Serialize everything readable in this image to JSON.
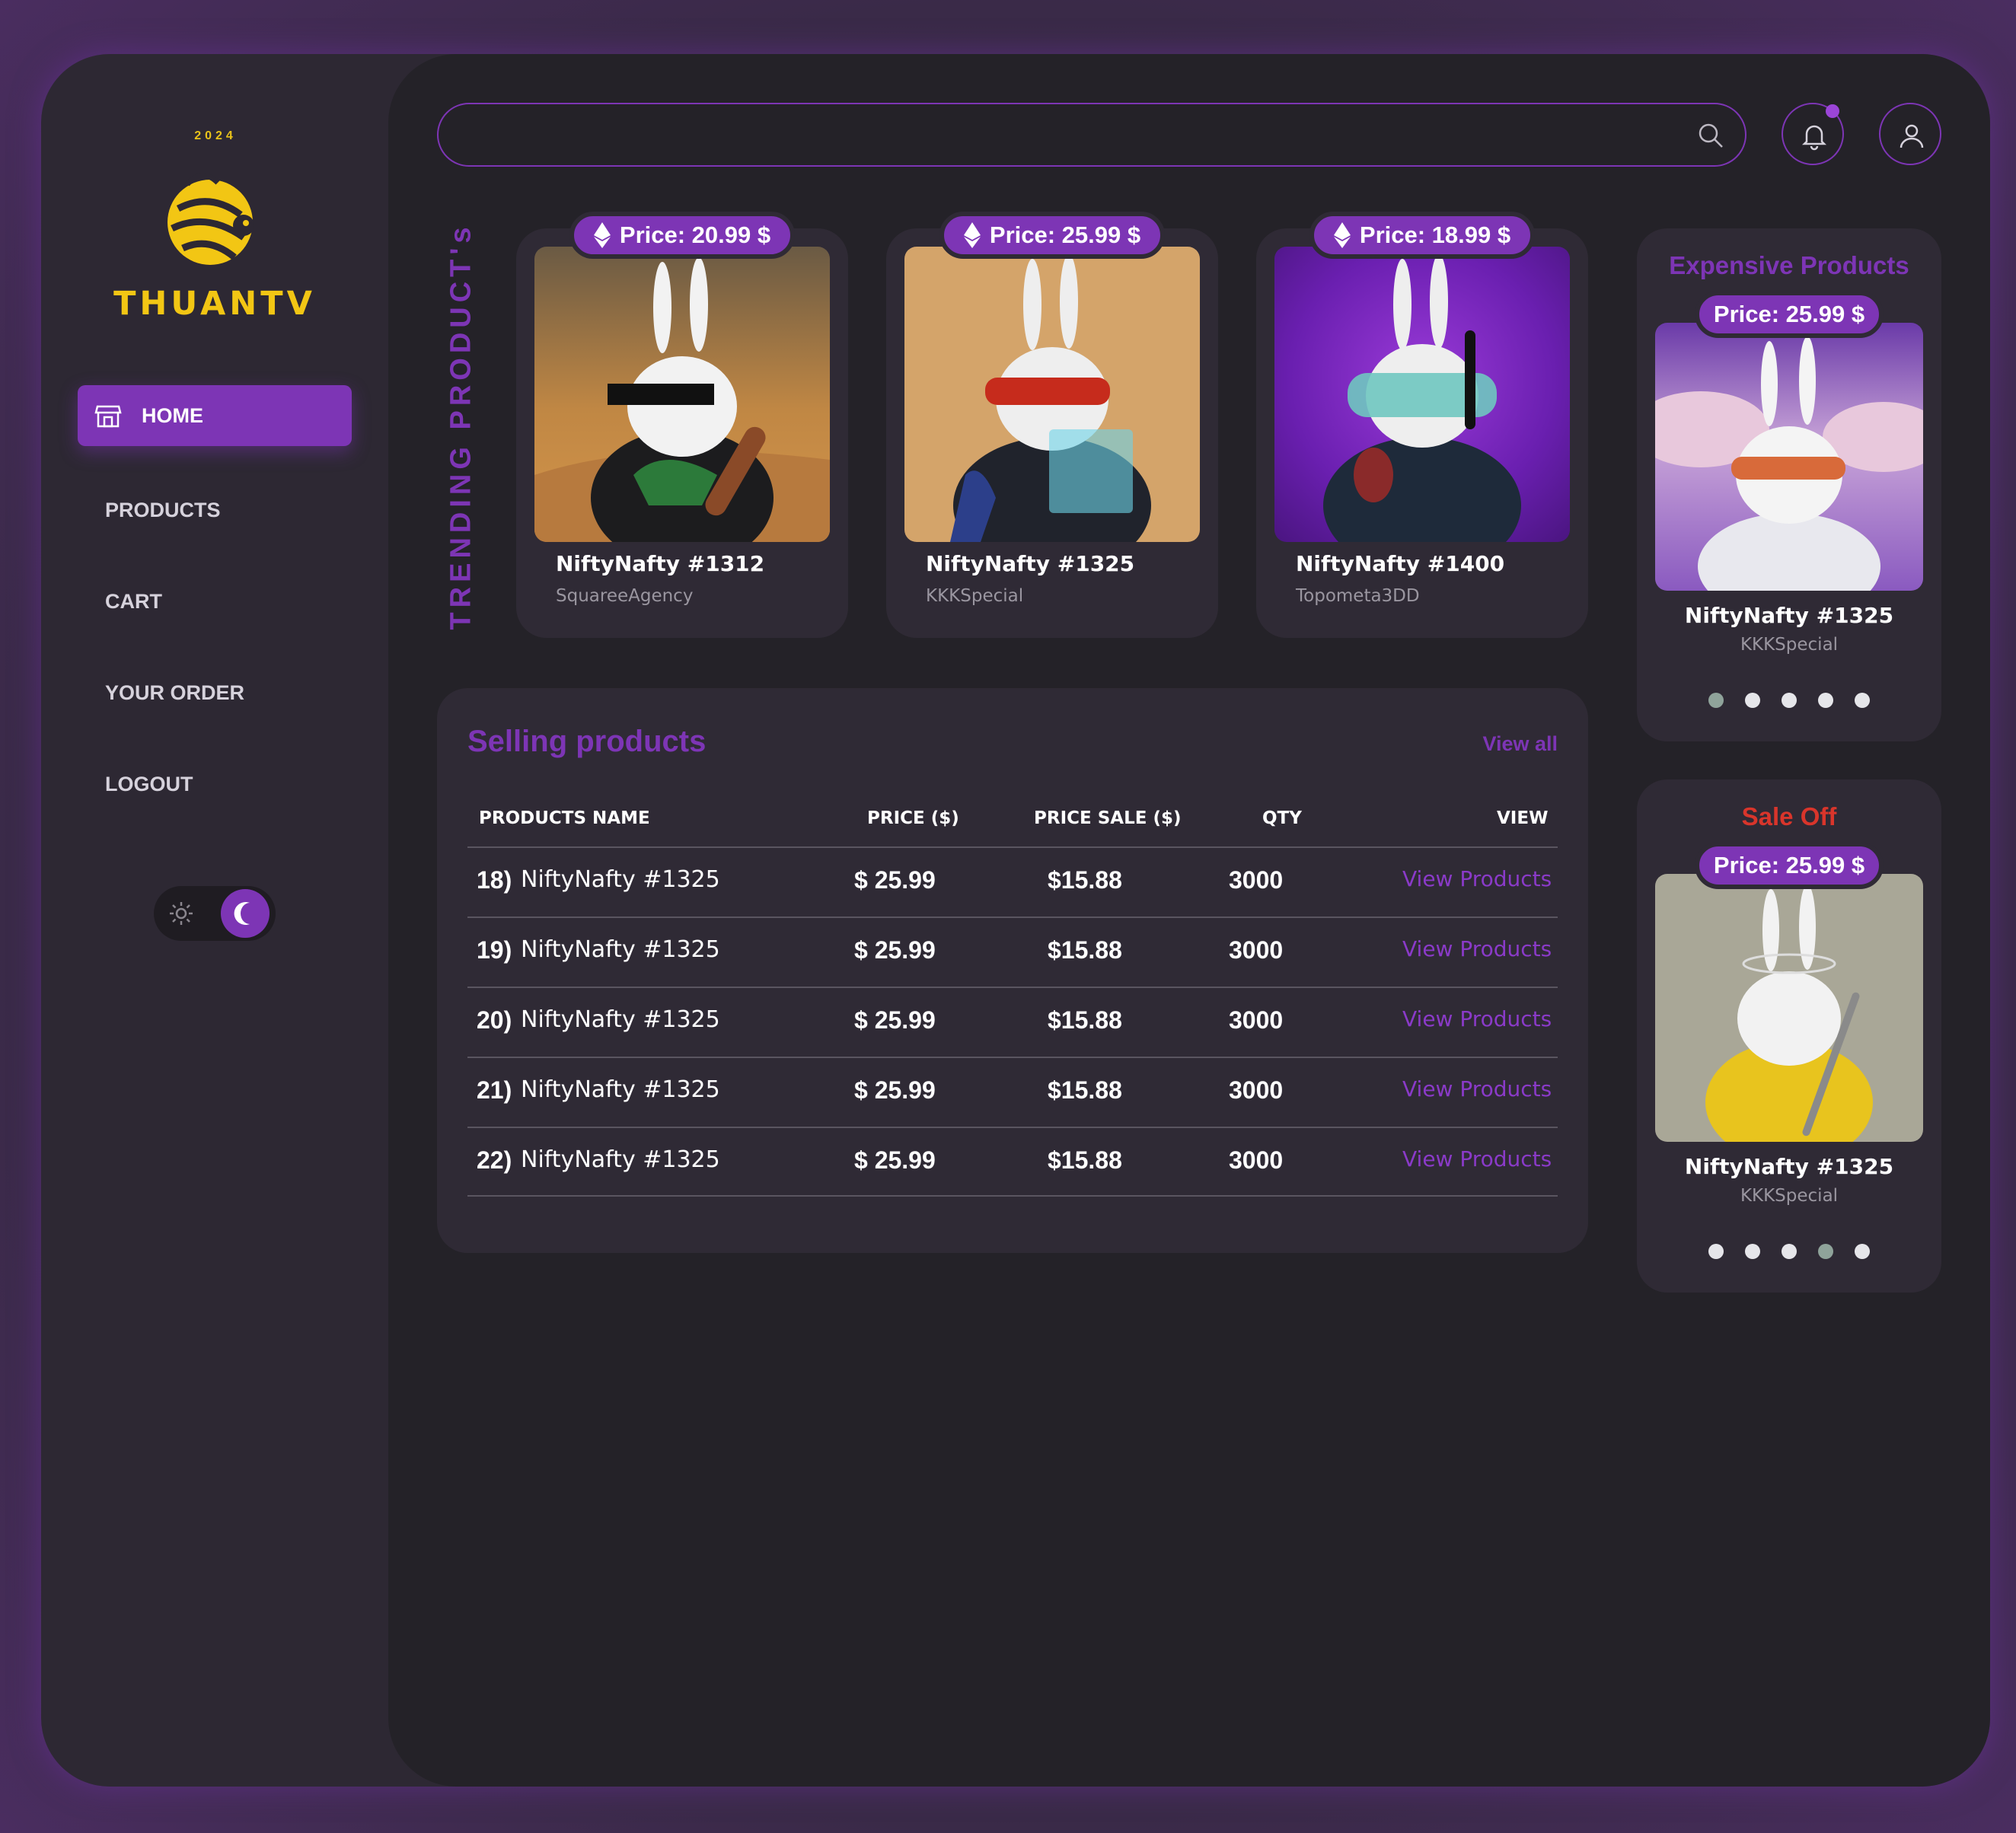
{
  "logo": {
    "year": "2024",
    "name": "THUANTV"
  },
  "colors": {
    "accent": "#7d35b5",
    "logo": "#f2c614",
    "sale": "#d9352b"
  },
  "sidebar": {
    "items": [
      {
        "label": "HOME",
        "active": true,
        "icon": "store-icon"
      },
      {
        "label": "PRODUCTS"
      },
      {
        "label": "CART"
      },
      {
        "label": "YOUR ORDER"
      },
      {
        "label": "LOGOUT"
      }
    ],
    "theme": "dark"
  },
  "header": {
    "search_value": "",
    "search_icon": "search-icon",
    "bell_icon": "bell-icon",
    "user_icon": "user-icon"
  },
  "trending": {
    "label": "TRENDING PRODUCT's",
    "cards": [
      {
        "price": "Price: 20.99 $",
        "name": "NiftyNafty #1312",
        "owner": "SquareeAgency"
      },
      {
        "price": "Price: 25.99 $",
        "name": "NiftyNafty #1325",
        "owner": "KKKSpecial"
      },
      {
        "price": "Price: 18.99 $",
        "name": "NiftyNafty #1400",
        "owner": "Topometa3DD"
      }
    ]
  },
  "selling": {
    "title": "Selling products",
    "view_all": "View all",
    "headers": [
      "PRODUCTS NAME",
      "PRICE ($)",
      "PRICE SALE ($)",
      "QTY",
      "VIEW"
    ],
    "rows": [
      {
        "no": "18)",
        "name": "NiftyNafty #1325",
        "price": "$ 25.99",
        "sale": "$15.88",
        "qty": "3000",
        "view": "View Products"
      },
      {
        "no": "19)",
        "name": "NiftyNafty #1325",
        "price": "$ 25.99",
        "sale": "$15.88",
        "qty": "3000",
        "view": "View Products"
      },
      {
        "no": "20)",
        "name": "NiftyNafty #1325",
        "price": "$ 25.99",
        "sale": "$15.88",
        "qty": "3000",
        "view": "View Products"
      },
      {
        "no": "21)",
        "name": "NiftyNafty #1325",
        "price": "$ 25.99",
        "sale": "$15.88",
        "qty": "3000",
        "view": "View Products"
      },
      {
        "no": "22)",
        "name": "NiftyNafty #1325",
        "price": "$ 25.99",
        "sale": "$15.88",
        "qty": "3000",
        "view": "View Products"
      }
    ]
  },
  "expensive": {
    "title": "Expensive Products",
    "price": "Price: 25.99 $",
    "name": "NiftyNafty #1325",
    "owner": "KKKSpecial",
    "active_dot": 0
  },
  "sale_off": {
    "title": "Sale Off",
    "price": "Price: 25.99 $",
    "name": "NiftyNafty #1325",
    "owner": "KKKSpecial",
    "active_dot": 3
  }
}
